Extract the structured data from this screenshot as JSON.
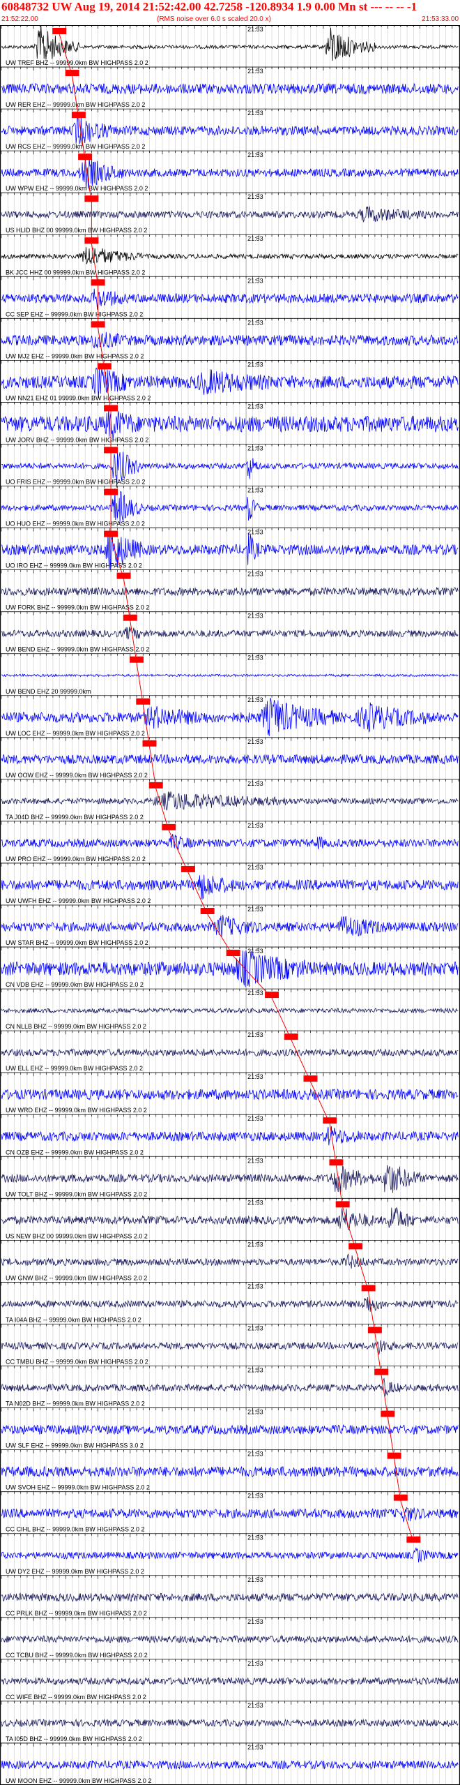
{
  "header": {
    "title": "60848732 UW Aug 19, 2014 21:52:42.00   42.7258 -120.8934  1.9 0.00 Mn st --- -- -- -1",
    "start_time": "21:52:22.00",
    "note": "(RMS noise over 6.0 s scaled 20.0 x)",
    "end_time": "21:53:33.00"
  },
  "chart_data": {
    "type": "line",
    "title": "60848732 UW Aug 19, 2014 21:52:42.00   42.7258 -120.8934  1.9 0.00 Mn st --- -- -- -1",
    "x_range_seconds": [
      0,
      71
    ],
    "x_start": "21:52:22.00",
    "x_end": "21:53:33.00",
    "minute_marker_label": "21:53",
    "minute_marker_seconds": 38,
    "grid_vertical": true,
    "pick_color": "#ff0000",
    "trace_colors": {
      "black": "#000000",
      "blue": "#0000ff",
      "navy": "#1a1a5e"
    },
    "traces": [
      {
        "label": "UW TREF BHZ -- 99999.0km BW  HIGHPASS  2.0  2",
        "color": "black",
        "base": 0.15,
        "events": [
          [
            5,
            12,
            1.9
          ],
          [
            50,
            58,
            1.7
          ]
        ],
        "pick": 9
      },
      {
        "label": "UW RER EHZ -- 99999.0km BW  HIGHPASS  2.0  2",
        "color": "blue",
        "base": 0.45,
        "events": [],
        "pick": 11
      },
      {
        "label": "UW RCS EHZ -- 99999.0km BW  HIGHPASS  2.0  2",
        "color": "blue",
        "base": 0.4,
        "events": [
          [
            11,
            17,
            1.2
          ]
        ],
        "pick": 12
      },
      {
        "label": "UW WPW EHZ -- 99999.0km BW  HIGHPASS  2.0  2",
        "color": "blue",
        "base": 0.35,
        "events": [
          [
            12,
            19,
            1.3
          ]
        ],
        "pick": 13
      },
      {
        "label": "US HLID BHZ 00 99999.0km BW  HIGHPASS  2.0  2",
        "color": "navy",
        "base": 0.3,
        "events": [
          [
            55,
            66,
            0.5
          ]
        ],
        "pick": 14
      },
      {
        "label": "BK JCC HHZ 00 99999.0km BW  HIGHPASS  2.0  2",
        "color": "black",
        "base": 0.2,
        "events": [
          [
            12,
            22,
            0.9
          ]
        ],
        "pick": 14
      },
      {
        "label": "CC SEP EHZ -- 99999.0km BW  HIGHPASS  2.0  2",
        "color": "blue",
        "base": 0.4,
        "events": [
          [
            14,
            19,
            0.8
          ]
        ],
        "pick": 15
      },
      {
        "label": "UW MJ2 EHZ -- 99999.0km BW  HIGHPASS  2.0  2",
        "color": "blue",
        "base": 0.45,
        "events": [
          [
            14,
            19,
            0.6
          ]
        ],
        "pick": 15
      },
      {
        "label": "UW NN21 EHZ 01 99999.0km BW  HIGHPASS  2.0  2",
        "color": "blue",
        "base": 0.55,
        "events": [
          [
            14,
            20,
            1.1
          ],
          [
            30,
            42,
            0.7
          ]
        ],
        "pick": 16
      },
      {
        "label": "UW JORV BHZ -- 99999.0km BW  HIGHPASS  2.0  2",
        "color": "blue",
        "base": 0.7,
        "events": [
          [
            16,
            21,
            1.0
          ]
        ],
        "pick": 17
      },
      {
        "label": "UO FRIS EHZ -- 99999.0km BW  HIGHPASS  2.0  2",
        "color": "blue",
        "base": 0.25,
        "events": [
          [
            17,
            22,
            1.8
          ],
          [
            38,
            40,
            1.3
          ]
        ],
        "pick": 17
      },
      {
        "label": "UO HUO EHZ -- 99999.0km BW  HIGHPASS  2.0  2",
        "color": "blue",
        "base": 0.25,
        "events": [
          [
            17,
            22,
            1.8
          ],
          [
            38,
            40,
            1.3
          ]
        ],
        "pick": 17
      },
      {
        "label": "UO IRO EHZ -- 99999.0km BW  HIGHPASS  2.0  2",
        "color": "blue",
        "base": 0.45,
        "events": [
          [
            16,
            22,
            1.9
          ],
          [
            38,
            40,
            1.4
          ]
        ],
        "pick": 17
      },
      {
        "label": "UW FORK BHZ -- 99999.0km BW  HIGHPASS  2.0  2",
        "color": "navy",
        "base": 0.35,
        "events": [],
        "pick": 19
      },
      {
        "label": "UW BEND EHZ -- 99999.0km BW  HIGHPASS  2.0  2",
        "color": "navy",
        "base": 0.3,
        "events": [
          [
            19,
            23,
            0.4
          ]
        ],
        "pick": 20
      },
      {
        "label": "UW BEND EHZ 20 99999.0km",
        "color": "blue",
        "base": 0.1,
        "events": [],
        "pick": 21
      },
      {
        "label": "UW LOC EHZ -- 99999.0km BW  HIGHPASS  2.0  2",
        "color": "blue",
        "base": 0.45,
        "events": [
          [
            22,
            32,
            0.7
          ],
          [
            40,
            52,
            1.4
          ],
          [
            55,
            66,
            1.0
          ]
        ],
        "pick": 22
      },
      {
        "label": "UW OOW EHZ -- 99999.0km BW  HIGHPASS  2.0  2",
        "color": "blue",
        "base": 0.4,
        "events": [],
        "pick": 23
      },
      {
        "label": "TA J04D BHZ -- 99999.0km BW  HIGHPASS  2.0  2",
        "color": "navy",
        "base": 0.25,
        "events": [
          [
            23,
            45,
            0.7
          ]
        ],
        "pick": 24
      },
      {
        "label": "UW PRO EHZ -- 99999.0km BW  HIGHPASS  2.0  2",
        "color": "blue",
        "base": 0.35,
        "events": [
          [
            26,
            30,
            0.5
          ],
          [
            49,
            50,
            0.7
          ]
        ],
        "pick": 26
      },
      {
        "label": "UW UWFH EHZ -- 99999.0km BW  HIGHPASS  2.0  2",
        "color": "blue",
        "base": 0.45,
        "events": [
          [
            30,
            36,
            1.0
          ]
        ],
        "pick": 29
      },
      {
        "label": "UW STAR BHZ -- 99999.0km BW  HIGHPASS  2.0  2",
        "color": "blue",
        "base": 0.4,
        "events": [
          [
            33,
            40,
            0.8
          ],
          [
            52,
            60,
            0.8
          ]
        ],
        "pick": 32
      },
      {
        "label": "CN VDB EHZ -- 99999.0km BW  HIGHPASS  2.0  2",
        "color": "blue",
        "base": 0.6,
        "events": [
          [
            36,
            48,
            1.2
          ]
        ],
        "pick": 36
      },
      {
        "label": "CN NLLB BHZ -- 99999.0km BW  HIGHPASS  2.0  2",
        "color": "navy",
        "base": 0.2,
        "events": [],
        "pick": 42
      },
      {
        "label": "UW ELL EHZ -- 99999.0km BW  HIGHPASS  2.0  2",
        "color": "navy",
        "base": 0.3,
        "events": [],
        "pick": 45
      },
      {
        "label": "UW WRD EHZ -- 99999.0km BW  HIGHPASS  2.0  2",
        "color": "blue",
        "base": 0.45,
        "events": [],
        "pick": 48
      },
      {
        "label": "CN OZB EHZ -- 99999.0km BW  HIGHPASS  2.0  2",
        "color": "blue",
        "base": 0.4,
        "events": [
          [
            50,
            56,
            0.6
          ]
        ],
        "pick": 51
      },
      {
        "label": "UW TOLT BHZ -- 99999.0km BW  HIGHPASS  2.0  2",
        "color": "navy",
        "base": 0.35,
        "events": [
          [
            51,
            58,
            1.1
          ],
          [
            59,
            65,
            1.5
          ]
        ],
        "pick": 52
      },
      {
        "label": "US NEW BHZ 00 99999.0km BW  HIGHPASS  2.0  2",
        "color": "navy",
        "base": 0.35,
        "events": [
          [
            52,
            58,
            1.0
          ],
          [
            60,
            64,
            1.3
          ]
        ],
        "pick": 53
      },
      {
        "label": "UW GNW BHZ -- 99999.0km BW  HIGHPASS  2.0  2",
        "color": "navy",
        "base": 0.3,
        "events": [
          [
            53,
            57,
            0.5
          ]
        ],
        "pick": 55
      },
      {
        "label": "TA I04A BHZ -- 99999.0km BW  HIGHPASS  2.0  2",
        "color": "navy",
        "base": 0.3,
        "events": [
          [
            56,
            60,
            0.7
          ]
        ],
        "pick": 57
      },
      {
        "label": "CC TMBU BHZ -- 99999.0km BW  HIGHPASS  2.0  2",
        "color": "navy",
        "base": 0.3,
        "events": [
          [
            58,
            61,
            0.6
          ]
        ],
        "pick": 58
      },
      {
        "label": "TA N02D BHZ -- 99999.0km BW  HIGHPASS  2.0  2",
        "color": "navy",
        "base": 0.3,
        "events": [
          [
            59,
            62,
            0.6
          ]
        ],
        "pick": 59
      },
      {
        "label": "UW SLF EHZ -- 99999.0km BW  HIGHPASS  3.0  2",
        "color": "blue",
        "base": 0.4,
        "events": [],
        "pick": 60
      },
      {
        "label": "UW SVOH EHZ -- 99999.0km BW  HIGHPASS  2.0  2",
        "color": "blue",
        "base": 0.45,
        "events": [],
        "pick": 61
      },
      {
        "label": "CC CIHL BHZ -- 99999.0km BW  HIGHPASS  2.0  2",
        "color": "blue",
        "base": 0.4,
        "events": [
          [
            62,
            66,
            0.5
          ]
        ],
        "pick": 62
      },
      {
        "label": "UW DY2 EHZ -- 99999.0km BW  HIGHPASS  2.0  2",
        "color": "blue",
        "base": 0.3,
        "events": [
          [
            64,
            67,
            0.5
          ]
        ],
        "pick": 64
      },
      {
        "label": "CC PRLK BHZ -- 99999.0km BW  HIGHPASS  2.0  2",
        "color": "navy",
        "base": 0.35,
        "events": [],
        "pick": null
      },
      {
        "label": "CC TCBU BHZ -- 99999.0km BW  HIGHPASS  2.0  2",
        "color": "navy",
        "base": 0.3,
        "events": [],
        "pick": null
      },
      {
        "label": "CC WIFE BHZ -- 99999.0km BW  HIGHPASS  2.0  2",
        "color": "navy",
        "base": 0.3,
        "events": [],
        "pick": null
      },
      {
        "label": "TA I05D BHZ -- 99999.0km BW  HIGHPASS  2.0  2",
        "color": "navy",
        "base": 0.3,
        "events": [],
        "pick": null
      },
      {
        "label": "UW MOON EHZ -- 99999.0km BW  HIGHPASS  2.0  2",
        "color": "blue",
        "base": 0.35,
        "events": [],
        "pick": null
      }
    ]
  }
}
